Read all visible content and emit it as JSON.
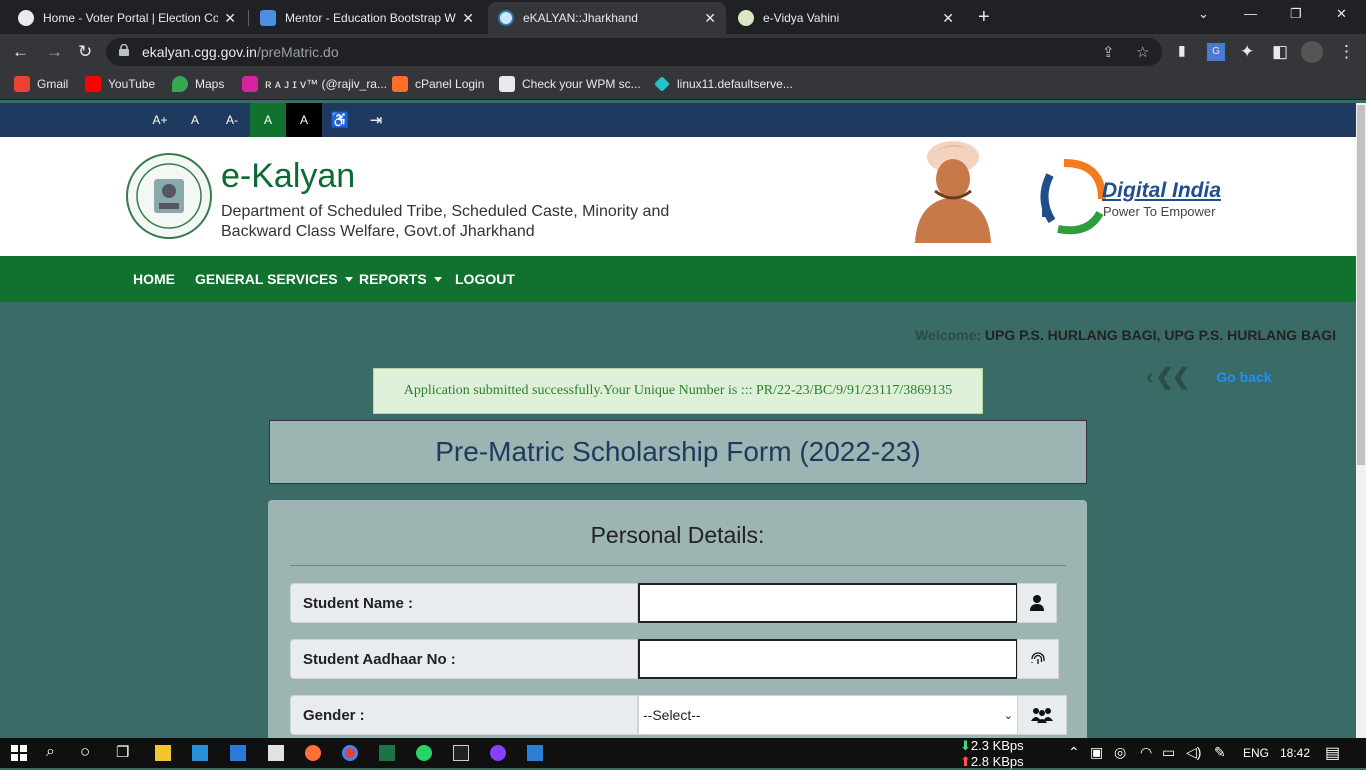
{
  "browser": {
    "tabs": [
      {
        "title": "Home - Voter Portal | Election Co",
        "active": false
      },
      {
        "title": "Mentor - Education Bootstrap W",
        "active": false
      },
      {
        "title": "eKALYAN::Jharkhand",
        "active": true
      },
      {
        "title": "e-Vidya Vahini",
        "active": false
      }
    ],
    "url_host": "ekalyan.cgg.gov.in",
    "url_path": "/preMatric.do",
    "bookmarks": [
      "Gmail",
      "YouTube",
      "Maps",
      "ʀ ᴀ ᴊ ɪ v™ (@rajiv_ra...",
      "cPanel Login",
      "Check your WPM sc...",
      "linux11.defaultserve..."
    ]
  },
  "accessibility": {
    "a_plus": "A+",
    "a": "A",
    "a_minus": "A-",
    "a_green": "A",
    "a_black": "A"
  },
  "header": {
    "title": "e-Kalyan",
    "subtitle": "Department of Scheduled Tribe, Scheduled Caste, Minority and Backward Class Welfare, Govt.of Jharkhand",
    "di_title": "Digital India",
    "di_sub": "Power To Empower"
  },
  "nav": {
    "home": "HOME",
    "general_services": "GENERAL SERVICES",
    "reports": "REPORTS",
    "logout": "LOGOUT"
  },
  "welcome": {
    "label": "Welcome:",
    "user": "UPG P.S. HURLANG BAGI, UPG P.S. HURLANG BAGI"
  },
  "go_back": "Go back",
  "alert": "Application submitted successfully.Your Unique Number is ::: PR/22-23/BC/9/91/23117/3869135",
  "form": {
    "title": "Pre-Matric Scholarship Form (2022-23)",
    "section": "Personal Details:",
    "student_name_label": "Student Name :",
    "student_name_value": "",
    "aadhaar_label": "Student Aadhaar No :",
    "aadhaar_value": "",
    "gender_label": "Gender :",
    "gender_selected": "--Select--"
  },
  "taskbar": {
    "down_speed": "2.3 KBps",
    "up_speed": "2.8 KBps",
    "lang": "ENG",
    "time": "18:42"
  },
  "colors": {
    "nav_green": "#10722e",
    "topbar_blue": "#1e3a5f",
    "page_bg": "#3a6b66",
    "card_bg": "#9cb4b2"
  }
}
